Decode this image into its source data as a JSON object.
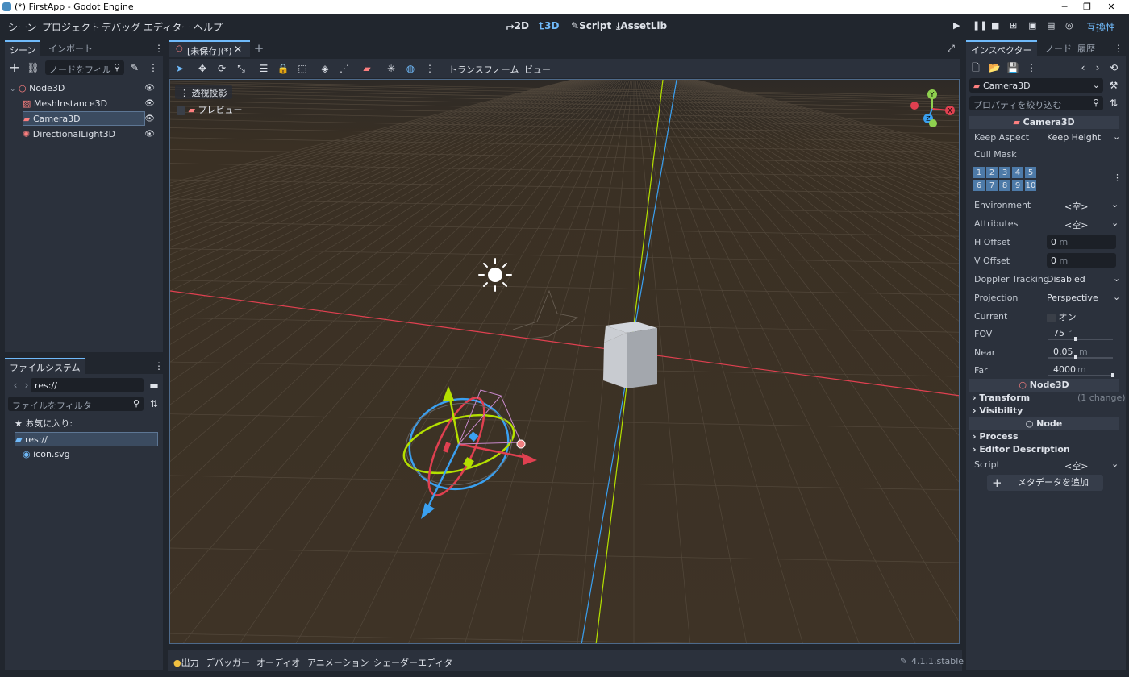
{
  "window": {
    "title": "(*) FirstApp - Godot Engine",
    "min": "─",
    "max": "❐",
    "close": "✕"
  },
  "menu": {
    "items": [
      "シーン",
      "プロジェクト",
      "デバッグ",
      "エディター",
      "ヘルプ"
    ]
  },
  "workspaces": [
    {
      "icon": "2d-icon",
      "glyph": "⮣",
      "label": "2D"
    },
    {
      "icon": "3d-icon",
      "glyph": "⮤",
      "label": "3D",
      "active": true
    },
    {
      "icon": "script-icon",
      "glyph": "✎",
      "label": "Script"
    },
    {
      "icon": "assetlib-icon",
      "glyph": "⤓",
      "label": "AssetLib"
    }
  ],
  "renderer": "互換性",
  "scene_dock": {
    "tabs": [
      "シーン",
      "インポート"
    ],
    "filter_placeholder": "ノードをフィル",
    "nodes": [
      {
        "name": "Node3D",
        "icon": "node3d-icon",
        "color": "#fc7f7f"
      },
      {
        "name": "MeshInstance3D",
        "icon": "mesh-icon",
        "color": "#fc7f7f"
      },
      {
        "name": "Camera3D",
        "icon": "camera-icon",
        "color": "#fc7f7f",
        "selected": true
      },
      {
        "name": "DirectionalLight3D",
        "icon": "light-icon",
        "color": "#fc7f7f"
      }
    ]
  },
  "filesystem_dock": {
    "tab": "ファイルシステム",
    "path": "res://",
    "filter_placeholder": "ファイルをフィルタ",
    "favorites": "お気に入り:",
    "items": [
      {
        "name": "res://",
        "selected": true
      },
      {
        "name": "icon.svg"
      }
    ]
  },
  "editor": {
    "scene_tab": "[未保存](*)",
    "toolbar_menus": [
      "トランスフォーム",
      "ビュー"
    ],
    "view_menu": "透視投影",
    "preview": "プレビュー"
  },
  "gizmo": {
    "x": "X",
    "y": "Y",
    "z": "Z"
  },
  "inspector": {
    "tabs": [
      "インスペクター",
      "ノード",
      "履歴"
    ],
    "object": "Camera3D",
    "filter_placeholder": "プロパティを絞り込む",
    "class_header": "Camera3D",
    "props": {
      "keep_aspect_label": "Keep Aspect",
      "keep_aspect": "Keep Height",
      "cull_mask_label": "Cull Mask",
      "cull_row1": [
        "1",
        "2",
        "3",
        "4",
        "5"
      ],
      "cull_row2": [
        "6",
        "7",
        "8",
        "9",
        "10"
      ],
      "environment_label": "Environment",
      "environment": "<空>",
      "attributes_label": "Attributes",
      "attributes": "<空>",
      "h_offset_label": "H Offset",
      "h_offset": "0",
      "h_offset_unit": "m",
      "v_offset_label": "V Offset",
      "v_offset": "0",
      "v_offset_unit": "m",
      "doppler_label": "Doppler Tracking",
      "doppler": "Disabled",
      "projection_label": "Projection",
      "projection": "Perspective",
      "current_label": "Current",
      "current": "オン",
      "fov_label": "FOV",
      "fov": "75",
      "fov_unit": "°",
      "near_label": "Near",
      "near": "0.05",
      "near_unit": "m",
      "far_label": "Far",
      "far": "4000",
      "far_unit": "m"
    },
    "node3d_header": "Node3D",
    "transform": "Transform",
    "transform_note": "(1 change)",
    "visibility": "Visibility",
    "node_header": "Node",
    "process": "Process",
    "editor_description": "Editor Description",
    "script_label": "Script",
    "script": "<空>",
    "add_metadata": "メタデータを追加"
  },
  "bottom": {
    "tabs": [
      "出力",
      "デバッガー",
      "オーディオ",
      "アニメーション",
      "シェーダーエディタ"
    ],
    "version": "4.1.1.stable"
  },
  "colors": {
    "accent": "#70bafa",
    "ground": "#3e3326",
    "axis_x": "#e04050",
    "axis_y": "#b4e000",
    "axis_z": "#3aa0f0"
  }
}
